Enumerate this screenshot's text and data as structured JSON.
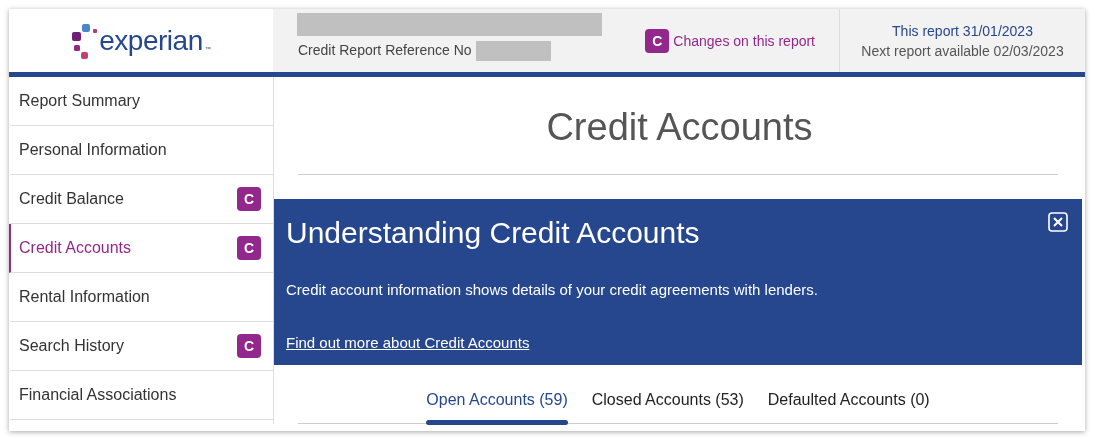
{
  "header": {
    "logo": {
      "text": "experian",
      "mark": "™"
    },
    "reference_label": "Credit Report Reference No",
    "changes_badge": "C",
    "changes_link": "Changes on this report",
    "this_report": "This report 31/01/2023",
    "next_report": "Next report available 02/03/2023"
  },
  "sidebar": {
    "items": [
      {
        "label": "Report Summary",
        "selected": false
      },
      {
        "label": "Personal Information",
        "selected": false
      },
      {
        "label": "Credit Balance",
        "selected": false,
        "badge": "C"
      },
      {
        "label": "Credit Accounts",
        "selected": true,
        "badge": "C"
      },
      {
        "label": "Rental Information",
        "selected": false
      },
      {
        "label": "Search History",
        "selected": false,
        "badge": "C"
      },
      {
        "label": "Financial Associations",
        "selected": false
      }
    ]
  },
  "main": {
    "title": "Credit Accounts",
    "banner": {
      "title": "Understanding Credit Accounts",
      "text": "Credit account information shows details of your credit agreements with lenders.",
      "link": "Find out more about Credit Accounts"
    },
    "tabs": [
      {
        "label": "Open Accounts (59)",
        "selected": true
      },
      {
        "label": "Closed Accounts (53)",
        "selected": false
      },
      {
        "label": "Defaulted Accounts (0)",
        "selected": false
      }
    ]
  }
}
